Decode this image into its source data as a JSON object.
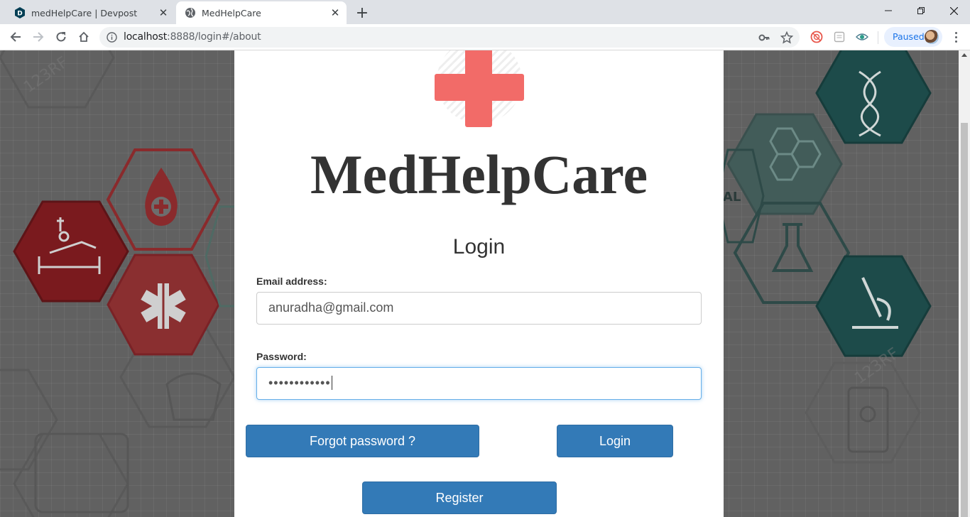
{
  "browser": {
    "tabs": [
      {
        "title": "medHelpCare | Devpost",
        "active": false,
        "favicon": "devpost-icon"
      },
      {
        "title": "MedHelpCare",
        "active": true,
        "favicon": "globe-icon"
      }
    ],
    "url_host": "localhost",
    "url_rest": ":8888/login#/about",
    "profile_status": "Paused"
  },
  "page": {
    "brand": "MedHelpCare",
    "heading": "Login",
    "email_label": "Email address:",
    "email_value": "anuradha@gmail.com",
    "password_label": "Password:",
    "password_masked": "••••••••••••",
    "forgot_label": "Forgot password ?",
    "login_label": "Login",
    "register_label": "Register"
  },
  "colors": {
    "primary_button": "#337ab7",
    "logo_cross": "#f26b68",
    "focus_border": "#66afe9"
  }
}
